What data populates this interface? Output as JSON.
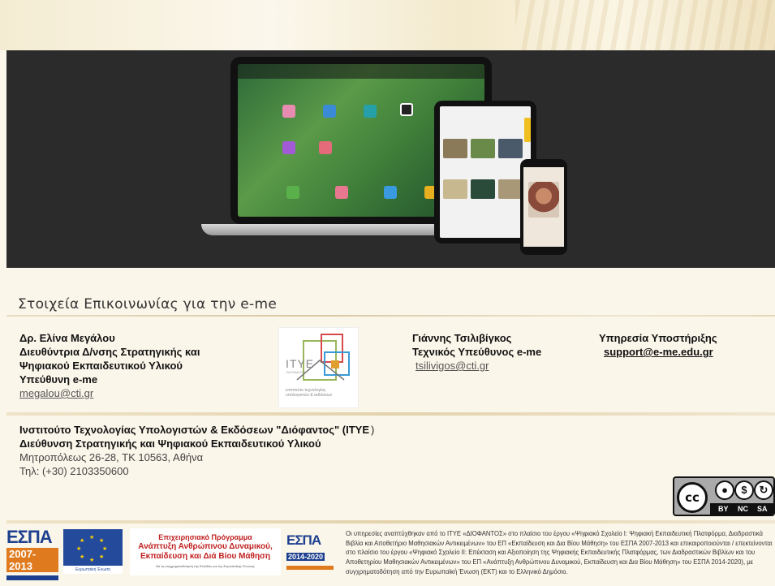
{
  "section_title": "Στοιχεία Επικοινωνίας για την e-me",
  "contact1": {
    "name": "Δρ. Ελίνα Μεγάλου",
    "role_line1": "Διευθύντρια Δ/νσης Στρατηγικής και",
    "role_line2": "Ψηφιακού Εκπαιδευτικού Υλικού",
    "role_line3": "Υπεύθυνη  e-me",
    "email": "megalou@cti.gr"
  },
  "logo": {
    "big": "ΙΤΥΕ",
    "sub": "\"ΔΙΟΦΑΝΤΟΣ\"",
    "desc": "ινστιτούτο τεχνολογίας υπολογιστών & εκδόσεων"
  },
  "contact2": {
    "name": "Γιάννης Τσιλιβίγκος",
    "role": "Τεχνικός Υπεύθυνος e-me",
    "email": "tsilivigos@cti.gr"
  },
  "support": {
    "title": "Υπηρεσία Υποστήριξης",
    "email": "support@e-me.edu.gr"
  },
  "institute": {
    "name": "Ινστιτούτο Τεχνολογίας Υπολογιστών & Εκδόσεων \"Διόφαντος\" (ΙΤΥΕ",
    "name_tail": ")",
    "division": "Διεύθυνση Στρατηγικής και Ψηφιακού Εκπαιδευτικού Υλικού",
    "address": "Μητροπόλεως 26-28, ΤΚ 10563, Αθήνα",
    "phone": "Τηλ: (+30) 2103350600"
  },
  "license": {
    "cc": "cc",
    "by": "BY",
    "nc": "NC",
    "sa": "SA"
  },
  "footer": {
    "espa1_word": "ΕΣΠΑ",
    "espa1_years": "2007-2013",
    "eu_caption": "Ευρωπαϊκή Ένωση",
    "op_line1": "Επιχειρησιακό Πρόγραμμα",
    "op_line2": "Ανάπτυξη Ανθρώπινου Δυναμικού,",
    "op_line3": "Εκπαίδευση και Διά Βίου Μάθηση",
    "op_line4": "Με τη συγχρηματοδότηση της Ελλάδας και της Ευρωπαϊκής Ένωσης",
    "espa2_word": "ΕΣΠΑ",
    "espa2_years": "2014-2020",
    "funding_text": "Οι υπηρεσίες αναπτύχθηκαν από το ΙΤΥΕ «ΔΙΟΦΑΝΤΟΣ» στο πλαίσιο του έργου «Ψηφιακό Σχολείο Ι: Ψηφιακή Εκπαιδευτική Πλατφόρμα, Διαδραστικά Βιβλία και Αποθετήριο Μαθησιακών Αντικειμένων» του ΕΠ «Εκπαίδευση και Δια Βίου Μάθηση» του ΕΣΠΑ 2007-2013  και επικαιροποιούνται / επεκτείνονται στο πλαίσιο του έργου  «Ψηφιακό Σχολείο ΙΙ: Επέκταση και Αξιοποίηση της Ψηφιακής Εκπαιδευτικής Πλατφόρμας, των Διαδραστικών Βιβλίων και του Αποθετηρίου Μαθησιακών Αντικειμένων» του ΕΠ «Ανάπτυξη Ανθρώπινου Δυναμικού, Εκπαίδευση και Δια Βίου Μάθηση» του ΕΣΠΑ 2014-2020),  με συγχρηματοδότηση από την  Ευρωπαϊκή Ένωση (ΕΚΤ) και το Ελληνικό Δημόσιο."
  }
}
